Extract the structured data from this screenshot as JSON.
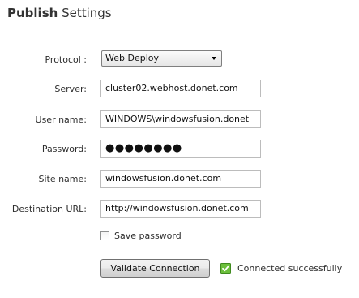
{
  "header": {
    "title_bold": "Publish",
    "title_rest": "Settings"
  },
  "form": {
    "protocol": {
      "label": "Protocol :",
      "value": "Web Deploy"
    },
    "server": {
      "label": "Server:",
      "value": "cluster02.webhost.donet.com"
    },
    "username": {
      "label": "User name:",
      "value": "WINDOWS\\windowsfusion.donet"
    },
    "password": {
      "label": "Password:",
      "value": "●●●●●●●●"
    },
    "site_name": {
      "label": "Site name:",
      "value": "windowsfusion.donet.com"
    },
    "destination_url": {
      "label": "Destination URL:",
      "value": "http://windowsfusion.donet.com"
    },
    "save_password": {
      "label": "Save password",
      "checked": false
    }
  },
  "actions": {
    "validate_label": "Validate Connection"
  },
  "status": {
    "text": "Connected successfully",
    "icon": "checkmark-icon",
    "color": "#5aa02c"
  }
}
